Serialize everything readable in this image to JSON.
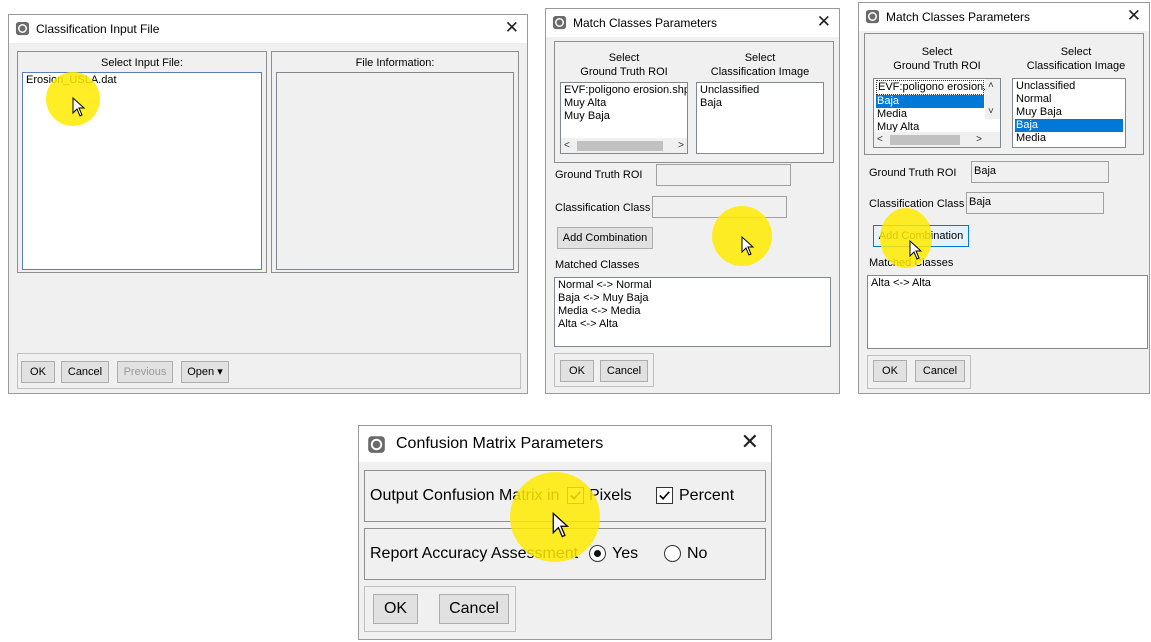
{
  "classification_input": {
    "title": "Classification Input File",
    "close": "✕",
    "select_label": "Select Input File:",
    "info_label": "File Information:",
    "files": [
      "Erosion_USLA.dat"
    ],
    "buttons": {
      "ok": "OK",
      "cancel": "Cancel",
      "previous": "Previous",
      "open": "Open ▾"
    }
  },
  "match_classes_1": {
    "title": "Match Classes Parameters",
    "close": "✕",
    "col1_header": "Select\nGround Truth ROI",
    "col2_header": "Select\nClassification Image",
    "roi_items": [
      "EVF:poligono erosion.shp",
      "Muy Alta",
      "Muy Baja"
    ],
    "class_items": [
      "Unclassified",
      "Baja"
    ],
    "ground_truth_label": "Ground Truth ROI",
    "ground_truth_value": "",
    "classification_label": "Classification Class",
    "classification_value": "",
    "add_combination": "Add Combination",
    "matched_label": "Matched Classes",
    "matched_items": [
      "Normal <-> Normal",
      "Baja <-> Muy Baja",
      "Media <-> Media",
      "Alta <-> Alta"
    ],
    "buttons": {
      "ok": "OK",
      "cancel": "Cancel"
    }
  },
  "match_classes_2": {
    "title": "Match Classes Parameters",
    "close": "✕",
    "col1_header": "Select\nGround Truth ROI",
    "col2_header": "Select\nClassification Image",
    "roi_items": [
      "EVF:poligono erosion.",
      "Baja",
      "Media",
      "Muy Alta"
    ],
    "roi_selected": "Baja",
    "class_items": [
      "Unclassified",
      "Normal",
      "Muy Baja",
      "Baja",
      "Media"
    ],
    "class_selected": "Baja",
    "ground_truth_label": "Ground Truth ROI",
    "ground_truth_value": "Baja",
    "classification_label": "Classification Class",
    "classification_value": "Baja",
    "add_combination": "Add Combination",
    "matched_label": "Matched Classes",
    "matched_items": [
      "Alta <-> Alta"
    ],
    "buttons": {
      "ok": "OK",
      "cancel": "Cancel"
    }
  },
  "confusion_matrix": {
    "title": "Confusion Matrix Parameters",
    "close": "✕",
    "output_label": "Output Confusion Matrix in",
    "pixels_label": "Pixels",
    "pixels_checked": true,
    "percent_label": "Percent",
    "percent_checked": true,
    "report_label": "Report Accuracy Assessment",
    "yes_label": "Yes",
    "no_label": "No",
    "report_selected": "Yes",
    "buttons": {
      "ok": "OK",
      "cancel": "Cancel"
    }
  },
  "colors": {
    "highlight": "#ffeb00",
    "selection": "#0078d7",
    "window_bg": "#f0f0f0"
  }
}
